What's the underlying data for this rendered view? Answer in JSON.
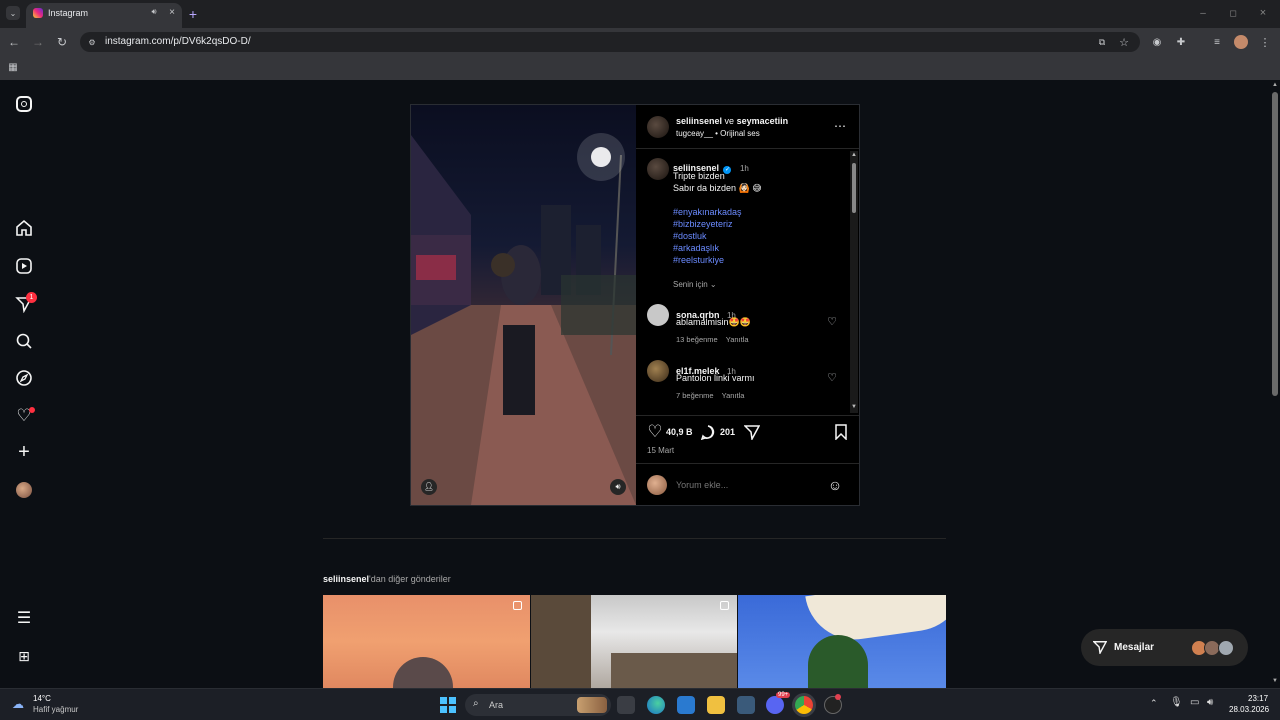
{
  "browser": {
    "tab_title": "Instagram",
    "url": "instagram.com/p/DV6k2qsDO-D/"
  },
  "sidebar": {
    "notification_badge": "1"
  },
  "post": {
    "header_user1": "seliinsenel",
    "header_and": "ve",
    "header_user2": "seymacetiin",
    "audio_user": "tugceay__",
    "audio_label": "• Orijinal ses",
    "caption_user": "seliinsenel",
    "caption_time": "1h",
    "caption_line1": "Tripte bizden",
    "caption_line2": "Sabır da bizden 🙆🏻 😅",
    "hashtags": [
      "#enyakınarkadaş",
      "#bizbizeyeteriz",
      "#dostluk",
      "#arkadaşlık",
      "#reelsturkiye"
    ],
    "for_you": "Senin için",
    "comments": [
      {
        "user": "sona.qrbn",
        "time": "1h",
        "text": "ablamalmisin🤩🤩",
        "likes": "13 beğenme",
        "reply": "Yanıtla"
      },
      {
        "user": "el1f.melek",
        "time": "1h",
        "text": "Pantolon linki varmı",
        "likes": "7 beğenme",
        "reply": "Yanıtla"
      }
    ],
    "like_count": "40,9 B",
    "comment_count": "201",
    "date": "15 Mart",
    "comment_placeholder": "Yorum ekle..."
  },
  "more_posts": {
    "user": "seliinsenel",
    "suffix": "'dan diğer gönderiler"
  },
  "messages": {
    "label": "Mesajlar"
  },
  "taskbar": {
    "temp": "14°C",
    "weather": "Hafif yağmur",
    "search": "Ara",
    "time": "23:17",
    "date": "28.03.2026",
    "discord_badge": "99+"
  }
}
